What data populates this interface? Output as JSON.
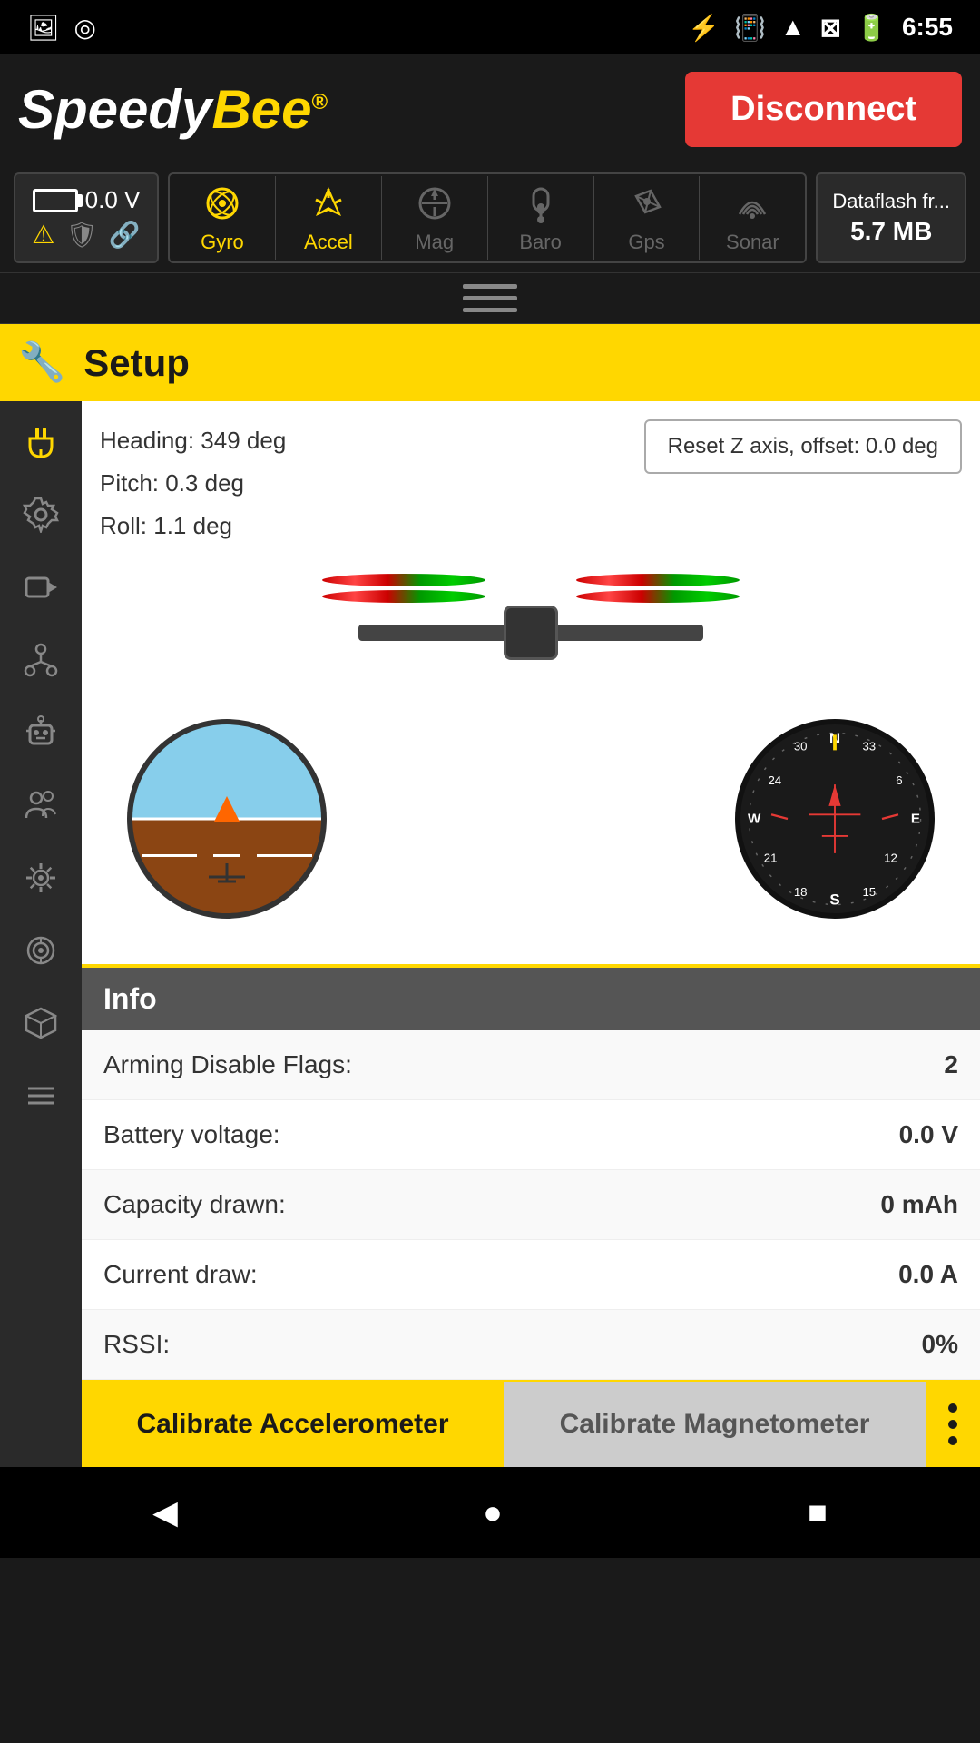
{
  "statusBar": {
    "time": "6:55",
    "icons": [
      "image",
      "circle",
      "bluetooth",
      "vibrate",
      "wifi",
      "signal-off",
      "battery"
    ]
  },
  "header": {
    "logo": "SpeedyBee",
    "disconnectLabel": "Disconnect"
  },
  "battery": {
    "voltage": "0.0 V",
    "iconLabels": [
      "warning",
      "shield",
      "link"
    ]
  },
  "sensors": [
    {
      "name": "Gyro",
      "active": true
    },
    {
      "name": "Accel",
      "active": true
    },
    {
      "name": "Mag",
      "active": false
    },
    {
      "name": "Baro",
      "active": false
    },
    {
      "name": "Gps",
      "active": false
    },
    {
      "name": "Sonar",
      "active": false
    }
  ],
  "dataflash": {
    "label": "Dataflash fr...",
    "size": "5.7 MB"
  },
  "section": {
    "title": "Setup"
  },
  "orientation": {
    "heading": "Heading: 349 deg",
    "pitch": "Pitch: 0.3 deg",
    "roll": "Roll: 1.1 deg",
    "resetButtonLabel": "Reset Z axis, offset: 0.0 deg"
  },
  "info": {
    "title": "Info",
    "rows": [
      {
        "label": "Arming Disable Flags:",
        "value": "2"
      },
      {
        "label": "Battery voltage:",
        "value": "0.0 V"
      },
      {
        "label": "Capacity drawn:",
        "value": "0 mAh"
      },
      {
        "label": "Current draw:",
        "value": "0.0 A"
      },
      {
        "label": "RSSI:",
        "value": "0%"
      }
    ]
  },
  "bottomButtons": {
    "calibrateAccelLabel": "Calibrate Accelerometer",
    "calibrateMagLabel": "Calibrate Magnetometer"
  },
  "sidebar": {
    "items": [
      {
        "icon": "plug",
        "name": "connect"
      },
      {
        "icon": "gear",
        "name": "settings"
      },
      {
        "icon": "video",
        "name": "camera"
      },
      {
        "icon": "hierarchy",
        "name": "ports"
      },
      {
        "icon": "robot",
        "name": "fc-settings"
      },
      {
        "icon": "users",
        "name": "pilots"
      },
      {
        "icon": "cog",
        "name": "pid"
      },
      {
        "icon": "filter",
        "name": "filters"
      },
      {
        "icon": "cube",
        "name": "modes"
      },
      {
        "icon": "menu",
        "name": "more"
      }
    ]
  }
}
